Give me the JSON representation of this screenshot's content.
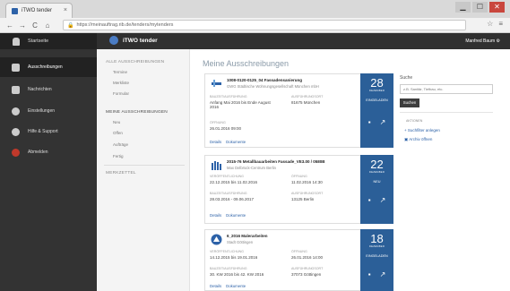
{
  "browser": {
    "tab_title": "iTWO tender",
    "url": "https://meinauftrag.rib.de/tenders/mytenders",
    "window_buttons": {
      "minimize": "▁",
      "maximize": "☐",
      "close": "✕"
    },
    "icons": {
      "back": "←",
      "forward": "→",
      "reload": "C",
      "home": "⌂",
      "lock": "🔒",
      "extensions": "☆",
      "menu": "≡"
    }
  },
  "app": {
    "brand": "iTWO tender",
    "user_menu": "Manfred Baum ⚙"
  },
  "sidebar": {
    "items": [
      {
        "label": "Startseite"
      },
      {
        "label": "Ausschreibungen"
      },
      {
        "label": "Nachrichten"
      },
      {
        "label": "Einstellungen"
      },
      {
        "label": "Hilfe & Support"
      },
      {
        "label": "Abmelden"
      }
    ]
  },
  "subnav": {
    "section_all": "ALLE AUSSCHREIBUNGEN",
    "all_items": [
      "Termine",
      "Merkliste",
      "Formular"
    ],
    "section_mine": "MEINE AUSSCHREIBUNGEN",
    "mine_items": [
      "Neu",
      "Offen",
      "Aufträge",
      "Fertig"
    ],
    "notepad": "MERKZETTEL"
  },
  "main": {
    "title": "Meine Ausschreibungen",
    "cards": [
      {
        "title": "1008-0120-0125_04 Fassadensanierung",
        "subtitle": "GWG Städtische Wohnungsgesellschaft München mbH",
        "label_period": "BAUZEIT/AUSFÜHRUNG",
        "period": "Anfang Mai 2016 bis Ende August 2016",
        "label_place": "AUSFÜHRUNGSORT",
        "place": "81675 München",
        "label_deadline": "ÖFFNUNG",
        "deadline": "26.01.2016 09:00",
        "day": "28",
        "month": "DEZEMBER",
        "status": "EINGELADEN"
      },
      {
        "title": "2015-76 Metallbauarbeiten Fassade_VE3.00 / 0580B",
        "subtitle": "Max Delbrück-Centrum Berlin",
        "label_published": "VERÖFFENTLICHUNG",
        "published": "22.12.2015 bis 11.02.2016",
        "label_opening": "ÖFFNUNG",
        "opening": "11.02.2016 14:30",
        "label_period": "BAUZEIT/AUSFÜHRUNG",
        "period": "28.03.2016 - 09.06.2017",
        "label_place": "AUSFÜHRUNGSORT",
        "place": "13125 Berlin",
        "day": "22",
        "month": "DEZEMBER",
        "status": "NEU"
      },
      {
        "title": "6_2016 Malerarbeiten",
        "subtitle": "Stadt Göttingen",
        "label_published": "VERÖFFENTLICHUNG",
        "published": "14.12.2015 bis 19.01.2016",
        "label_opening": "ÖFFNUNG",
        "opening": "26.01.2016 14:00",
        "label_period": "BAUZEIT/AUSFÜHRUNG",
        "period": "30. KW 2016 bis 42. KW 2016",
        "label_place": "AUSFÜHRUNGSORT",
        "place": "37073 Göttingen",
        "day": "18",
        "month": "DEZEMBER",
        "status": "EINGELADEN"
      }
    ],
    "card_link_details": "Details",
    "card_link_documents": "Dokumente"
  },
  "search": {
    "label": "Suche",
    "placeholder": "z.B. Sanitär, Tiefbau, etc.",
    "button": "Suchen",
    "actions_label": "AKTIONEN",
    "action_filter": "+ Suchfilter anlegen",
    "action_archive": "▣ Archiv öffnen"
  },
  "colors": {
    "sidebar": "#333333",
    "accent": "#2b5f98",
    "appbar": "#303030"
  }
}
